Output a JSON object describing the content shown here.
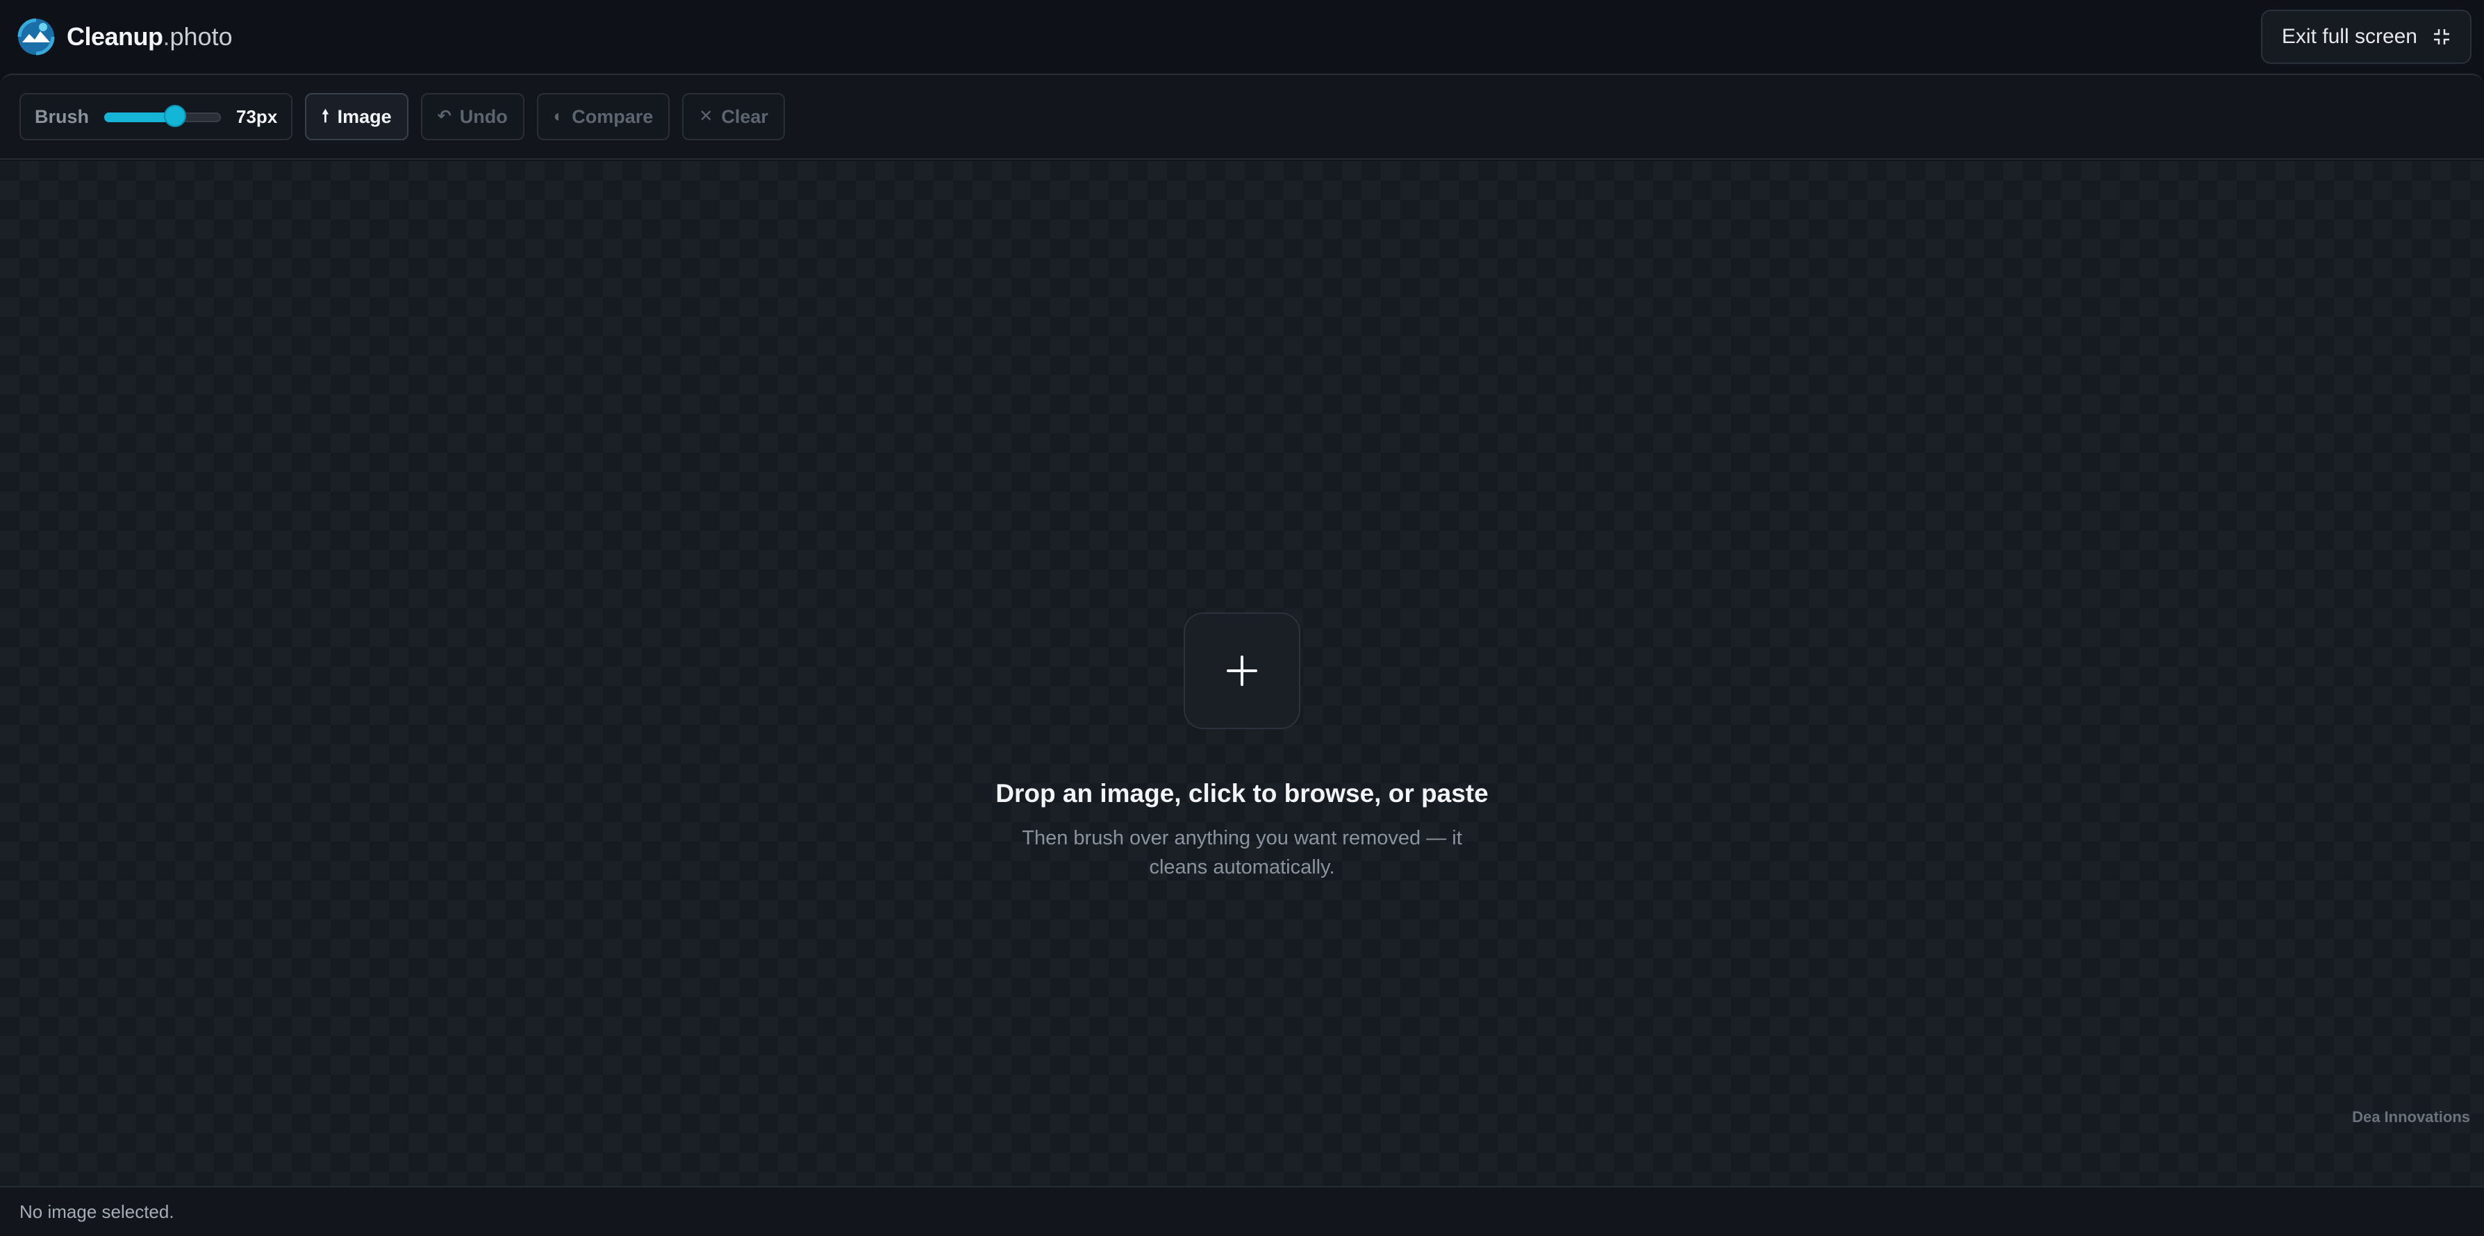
{
  "app": {
    "brand_name": "Cleanup",
    "brand_dot": ".",
    "brand_tld": "photo",
    "exit_label": "Exit full screen"
  },
  "toolbar": {
    "brush_label": "Brush",
    "brush_value": 73,
    "brush_value_label": "73px",
    "brush_min": 1,
    "brush_max": 120,
    "image_label": "Image",
    "undo_label": "Undo",
    "compare_label": "Compare",
    "clear_label": "Clear"
  },
  "dropzone": {
    "title": "Drop an image, click to browse, or paste",
    "subtitle": "Then brush over anything you want removed — it cleans automatically."
  },
  "credit": "Dea Innovations",
  "status": "No image selected.",
  "colors": {
    "accent": "#16b4d6",
    "background": "#0d1117"
  }
}
